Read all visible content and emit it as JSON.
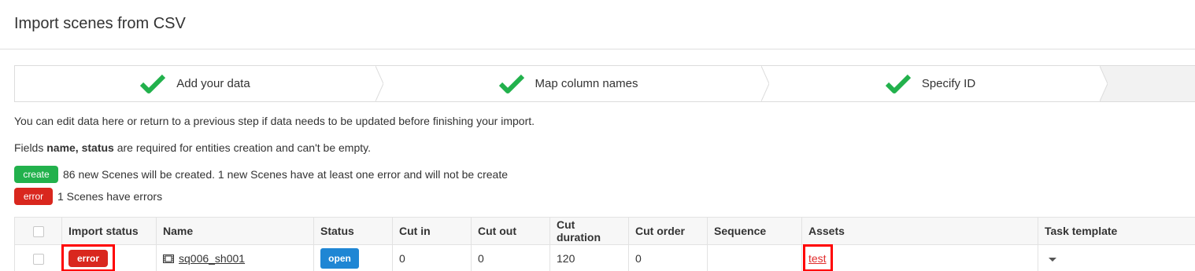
{
  "header": {
    "title": "Import scenes from CSV"
  },
  "steps": [
    {
      "label": "Add your data",
      "done": true
    },
    {
      "label": "Map column names",
      "done": true
    },
    {
      "label": "Specify ID",
      "done": true
    },
    {
      "label": "",
      "done": false
    }
  ],
  "info": {
    "edit_hint": "You can edit data here or return to a previous step if data needs to be updated before finishing your import.",
    "required_prefix": "Fields ",
    "required_fields": "name, status",
    "required_suffix": " are required for entities creation and can't be empty."
  },
  "summary": [
    {
      "tag": "create",
      "tag_color": "#22b14c",
      "text": "86 new Scenes will be created. 1 new Scenes have at least one error and will not be create"
    },
    {
      "tag": "error",
      "tag_color": "#d9271e",
      "text": "1 Scenes have errors"
    }
  ],
  "table": {
    "columns": [
      "Import status",
      "Name",
      "Status",
      "Cut in",
      "Cut out",
      "Cut duration",
      "Cut order",
      "Sequence",
      "Assets",
      "Task template"
    ],
    "rows": [
      {
        "import_status": "error",
        "name": "sq006_sh001",
        "status": "open",
        "cut_in": "0",
        "cut_out": "0",
        "cut_duration": "120",
        "cut_order": "0",
        "sequence": "",
        "assets": "test",
        "task_template": ""
      }
    ]
  },
  "colors": {
    "check_green": "#22b14c",
    "error_red": "#d9271e",
    "open_blue": "#1f86d4",
    "highlight_red": "#ff0000"
  }
}
